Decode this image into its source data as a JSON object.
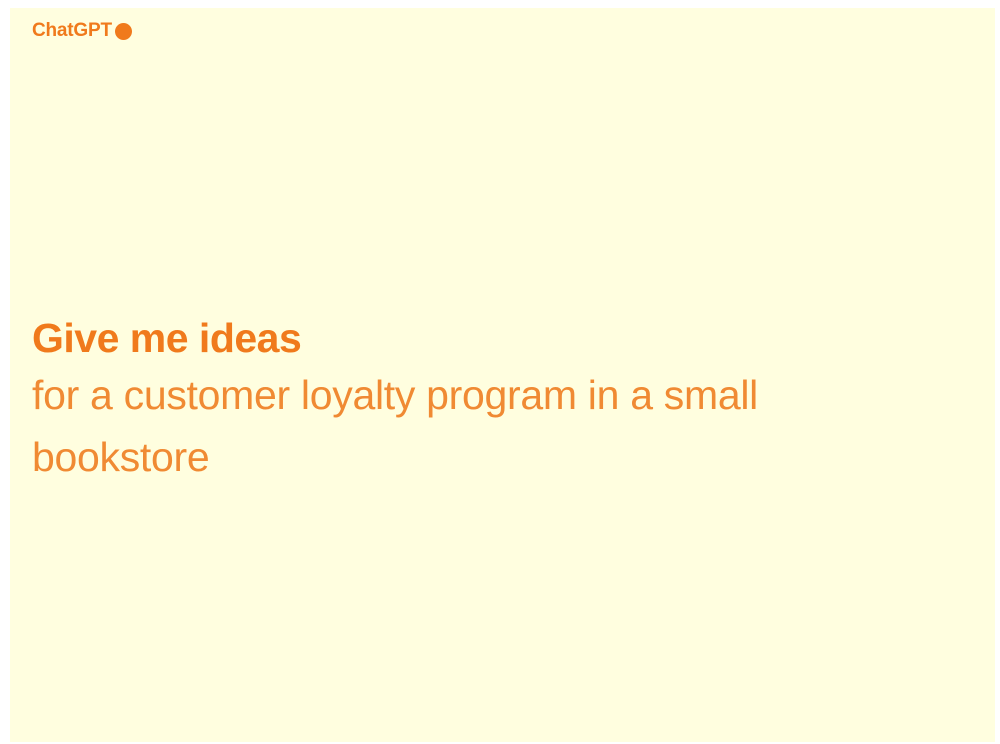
{
  "brand": {
    "name": "ChatGPT",
    "dot_icon": "filled-circle-icon"
  },
  "prompt": {
    "title": "Give me ideas",
    "body": "for a customer loyalty program in a small bookstore"
  },
  "colors": {
    "background": "#fffedf",
    "accent": "#f07a1c"
  }
}
